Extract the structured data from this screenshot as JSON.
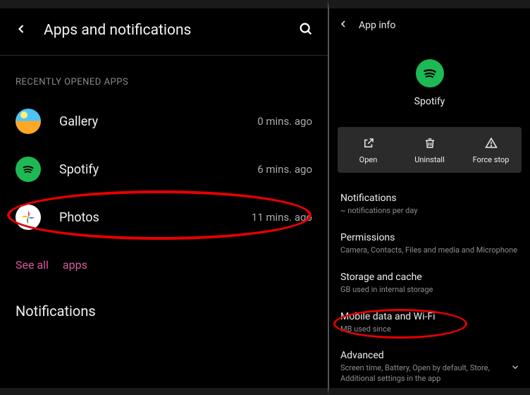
{
  "left": {
    "title": "Apps and notifications",
    "section_label": "RECENTLY OPENED APPS",
    "apps": [
      {
        "name": "Gallery",
        "time": "0 mins. ago"
      },
      {
        "name": "Spotify",
        "time": "6 mins. ago"
      },
      {
        "name": "Photos",
        "time": "11 mins. ago"
      }
    ],
    "see_all_prefix": "See all",
    "see_all_suffix": "apps",
    "notifications_label": "Notifications"
  },
  "right": {
    "header": "App info",
    "app_name": "Spotify",
    "actions": {
      "open": "Open",
      "uninstall": "Uninstall",
      "force_stop": "Force stop"
    },
    "items": [
      {
        "title": "Notifications",
        "sub": "~  notifications per day"
      },
      {
        "title": "Permissions",
        "sub": "Camera, Contacts, Files and media and Microphone"
      },
      {
        "title": "Storage and cache",
        "sub": "GB used in internal storage"
      },
      {
        "title": "Mobile data and Wi-Fi",
        "sub": "MB used since"
      },
      {
        "title": "Advanced",
        "sub": "Screen time, Battery, Open by default, Store, Additional settings in the app"
      }
    ]
  }
}
